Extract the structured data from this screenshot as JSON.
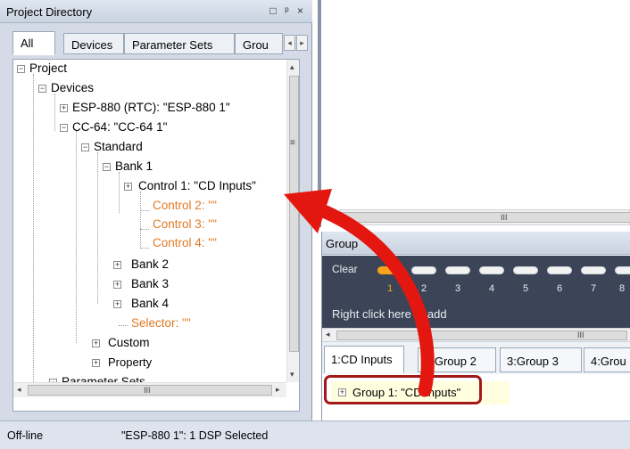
{
  "project_panel": {
    "title": "Project Directory",
    "controls": [
      "□",
      "ᵖ",
      "×"
    ],
    "tabs": [
      "All",
      "Devices",
      "Parameter Sets",
      "Grou"
    ],
    "scroll_arrows": {
      "left": "◂",
      "right": "▸",
      "up": "▴",
      "down": "▾"
    },
    "hscroll_grip": "III",
    "vscroll_grip": "≡",
    "tree": [
      {
        "label": "Project",
        "expander": "−"
      },
      {
        "label": "Devices",
        "expander": "−"
      },
      {
        "label": "ESP-880 (RTC): \"ESP-880 1\"",
        "expander": "+"
      },
      {
        "label": "CC-64: \"CC-64 1\"",
        "expander": "−"
      },
      {
        "label": "Standard",
        "expander": "−"
      },
      {
        "label": "Bank 1",
        "expander": "−"
      },
      {
        "label": "Control 1: \"CD Inputs\"",
        "expander": "+"
      },
      {
        "label": "Control 2: \"\"",
        "expander": ""
      },
      {
        "label": "Control 3: \"\"",
        "expander": ""
      },
      {
        "label": "Control 4: \"\"",
        "expander": ""
      },
      {
        "label": "Bank 2",
        "expander": "+"
      },
      {
        "label": "Bank 3",
        "expander": "+"
      },
      {
        "label": "Bank 4",
        "expander": "+"
      },
      {
        "label": "Selector: \"\"",
        "expander": ""
      },
      {
        "label": "Custom",
        "expander": "+"
      },
      {
        "label": "Property",
        "expander": "+"
      },
      {
        "label": "Parameter Sets",
        "expander": "−"
      }
    ]
  },
  "status_bar": {
    "mode": "Off-line",
    "message": "\"ESP-880 1\": 1 DSP Selected"
  },
  "top_scroll_grip": "III",
  "group_panel": {
    "title": "Group",
    "clear_label": "Clear",
    "buttons": [
      "1",
      "2",
      "3",
      "4",
      "5",
      "6",
      "7",
      "8"
    ],
    "selected_button": "1",
    "hint": "Right click here to add",
    "scroll_grip": "III",
    "scroll_left": "◂",
    "tabs": [
      "1:CD Inputs",
      "2:Group 2",
      "3:Group 3",
      "4:Grou"
    ],
    "group_item": {
      "expander": "+",
      "label": "Group 1: \"CD Inputs\""
    }
  },
  "colors": {
    "orange_text": "#e07a26",
    "selected_pill": "#f7a31c",
    "arrow_red": "#e3170f",
    "highlight_border": "#a31818"
  }
}
